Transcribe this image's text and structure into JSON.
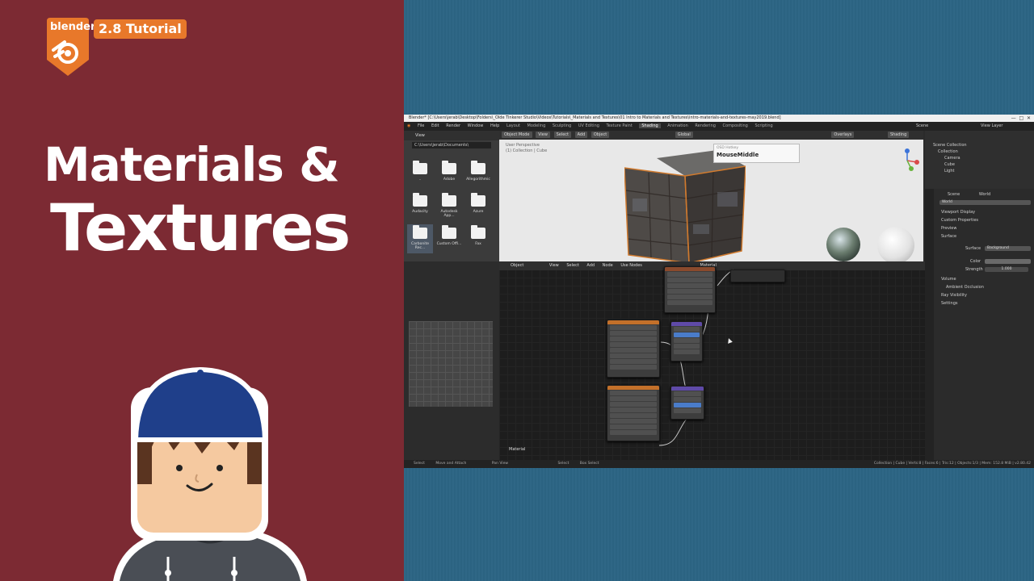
{
  "brand": {
    "logo_text": "blender",
    "badge": "2.8 Tutorial"
  },
  "title": {
    "line1": "Materials &",
    "line2": "Textures"
  },
  "colors": {
    "left_bg": "#7c2a33",
    "right_bg": "#2c6584",
    "brand_orange": "#e8782a"
  },
  "blender": {
    "window_title": "Blender* [C:\\Users\\jerab\\Desktop\\Folders\\_Olde Tinkerer Studio\\Videos\\Tutorials\\_Materials and Textures\\01 Intro to Materials and Textures\\intro-materials-and-textures-may2019.blend]",
    "menu": [
      "File",
      "Edit",
      "Render",
      "Window",
      "Help"
    ],
    "workspaces": [
      "Layout",
      "Modeling",
      "Sculpting",
      "UV Editing",
      "Texture Paint",
      "Shading",
      "Animation",
      "Rendering",
      "Compositing",
      "Scripting"
    ],
    "active_workspace": "Shading",
    "scene": "Scene",
    "view_layer": "View Layer",
    "file_browser": {
      "header": "View",
      "path": "C:\\Users\\jerab\\Documents\\",
      "folders": [
        "..",
        "Adobe",
        "Allegorithmic",
        "Audacity",
        "Autodesk App...",
        "Azure",
        "Carbonite Rec...",
        "Custom Offi...",
        "Fax"
      ]
    },
    "viewport": {
      "mode": "Object Mode",
      "menu": [
        "View",
        "Select",
        "Add",
        "Object"
      ],
      "orientation": "Global",
      "overlays": "Overlays",
      "shading": "Shading",
      "info_line1": "User Perspective",
      "info_line2": "(1) Collection | Cube",
      "popup_key": "OSD Hotkey",
      "popup_value": "MouseMiddle"
    },
    "outliner": {
      "items": [
        "Scene Collection",
        "Collection",
        "Camera",
        "Cube",
        "Light"
      ]
    },
    "properties": {
      "scene_tab": "Scene",
      "world_tab": "World",
      "world_name": "World",
      "panels": [
        "Viewport Display",
        "Custom Properties",
        "Preview",
        "Surface"
      ],
      "surface_label": "Surface",
      "surface_value": "Background",
      "color_label": "Color",
      "strength_label": "Strength",
      "strength_value": "1.000",
      "panels2": [
        "Volume",
        "Ambient Occlusion",
        "Ray Visibility",
        "Settings"
      ]
    },
    "node_editor": {
      "header": [
        "View",
        "Select",
        "Add",
        "Node"
      ],
      "object": "Object",
      "use_nodes": "Use Nodes",
      "material": "Material",
      "footer_label": "Material"
    },
    "statusbar": {
      "left": [
        "Select",
        "Move and Attach",
        "Pan View",
        "Select",
        "Box Select"
      ],
      "right": "Collection | Cube | Verts:8 | Faces:6 | Tris:12 | Objects:1/3 | Mem: 152.8 MiB | v2.80.42"
    }
  }
}
